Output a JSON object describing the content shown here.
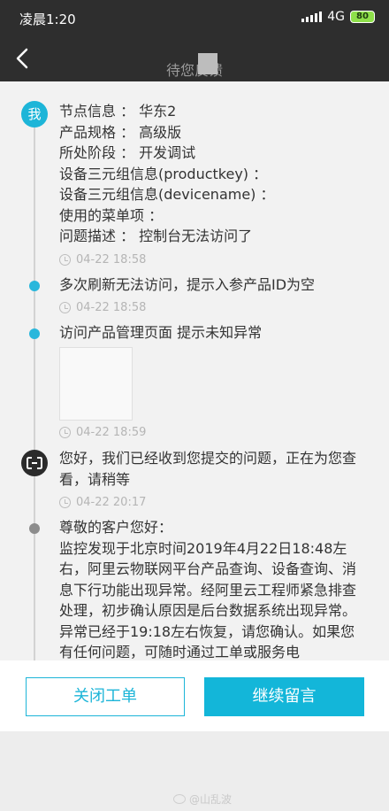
{
  "status_bar": {
    "time": "凌晨1:20",
    "network": "4G",
    "battery": "80",
    "battery_color": "#8ee04a"
  },
  "nav": {
    "title": "待您反馈",
    "back_icon": "chevron-left-icon"
  },
  "timeline": {
    "entry1": {
      "avatar": "我",
      "lines": [
        "节点信息 ： 华东2",
        "产品规格 ： 高级版",
        "所处阶段 ： 开发调试",
        "设备三元组信息(productkey) ：",
        "设备三元组信息(devicename) ：",
        "使用的菜单项 ：",
        "问题描述 ： 控制台无法访问了"
      ],
      "time": "04-22 18:58"
    },
    "entry2": {
      "text": "多次刷新无法访问，提示入参产品ID为空",
      "time": "04-22 18:58"
    },
    "entry3": {
      "text": "访问产品管理页面 提示未知异常",
      "time": "04-22 18:59"
    },
    "entry4": {
      "text": "您好，我们已经收到您提交的问题，正在为您查看，请稍等",
      "time": "04-22 20:17"
    },
    "entry5": {
      "greeting": "尊敬的客户您好：",
      "text": "监控发现于北京时间2019年4月22日18:48左右，阿里云物联网平台产品查询、设备查询、消息下行功能出现异常。经阿里云工程师紧急排查处理，初步确认原因是后台数据系统出现异常。异常已经于19:18左右恢复，请您确认。如果您有任何问题，可随时通过工单或服务电"
    }
  },
  "actions": {
    "close_label": "关闭工单",
    "continue_label": "继续留言",
    "accent": "#1db5d8"
  },
  "watermark": "@山乱波"
}
